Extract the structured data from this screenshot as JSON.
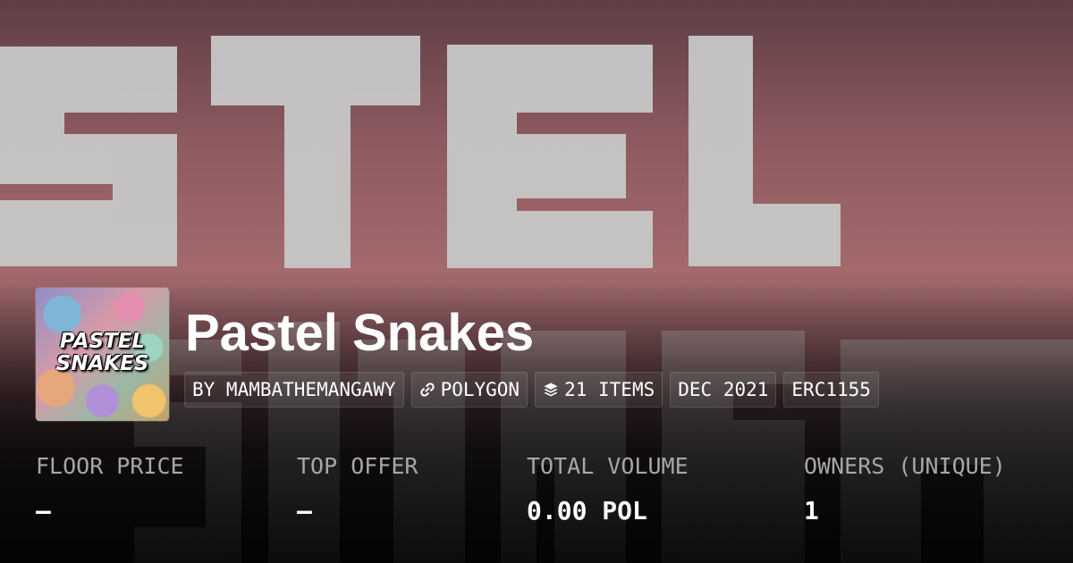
{
  "collection": {
    "name": "Pastel Snakes",
    "avatar_text_line1": "PASTEL",
    "avatar_text_line2": "SNAKES"
  },
  "chips": [
    {
      "label": "BY MAMBATHEMANGAWY",
      "icon": ""
    },
    {
      "label": "POLYGON",
      "icon": "link-icon"
    },
    {
      "label": "21 ITEMS",
      "icon": "layers-icon"
    },
    {
      "label": "DEC 2021",
      "icon": ""
    },
    {
      "label": "ERC1155",
      "icon": ""
    }
  ],
  "stats": [
    {
      "label": "FLOOR PRICE",
      "value": "—"
    },
    {
      "label": "TOP OFFER",
      "value": "—"
    },
    {
      "label": "TOTAL VOLUME",
      "value": "0.00 POL"
    },
    {
      "label": "OWNERS (UNIQUE)",
      "value": "1"
    }
  ],
  "colors": {
    "banner_pink": "#a46a6e",
    "banner_letters": "#c8c8c8",
    "label_gray": "#a7a7a7",
    "text_white": "#ffffff"
  }
}
